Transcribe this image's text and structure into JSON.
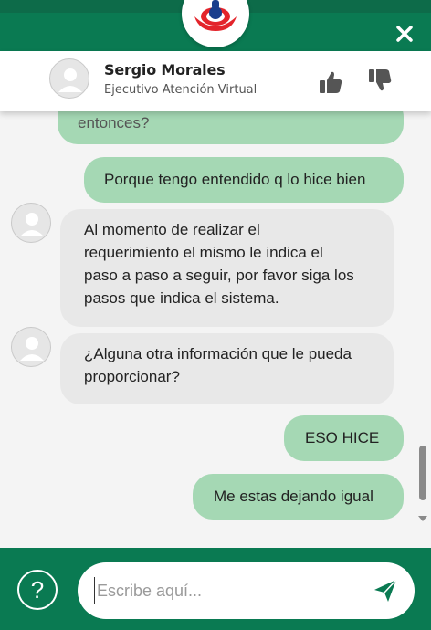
{
  "header": {
    "brand_icon": "brand-logo",
    "close_icon": "close-icon",
    "colors": {
      "brand_green": "#0a7a52",
      "logo_red": "#e3242b",
      "logo_blue": "#1a3e8c"
    }
  },
  "agent": {
    "name": "Sergio Morales",
    "role": "Ejecutivo Atención Virtual",
    "avatar_icon": "avatar-icon",
    "like_icon": "thumbs-up-icon",
    "dislike_icon": "thumbs-down-icon"
  },
  "chat": {
    "messages": [
      {
        "from": "user",
        "text": "entonces?"
      },
      {
        "from": "user",
        "text": "Porque tengo entendido q lo hice bien"
      },
      {
        "from": "agent",
        "text": "Al momento de realizar el requerimiento el mismo le indica el paso a paso a seguir, por favor siga los pasos que indica el sistema."
      },
      {
        "from": "agent",
        "text": "¿Alguna otra información que le pueda proporcionar?"
      },
      {
        "from": "user",
        "text": "ESO HICE"
      },
      {
        "from": "user",
        "text": "Me estas dejando igual"
      }
    ],
    "colors": {
      "user_bubble": "#a5d8b4",
      "agent_bubble": "#e8e8e8"
    }
  },
  "footer": {
    "help_label": "?",
    "input_placeholder": "Escribe aquí...",
    "input_value": "",
    "send_icon": "send-icon"
  }
}
